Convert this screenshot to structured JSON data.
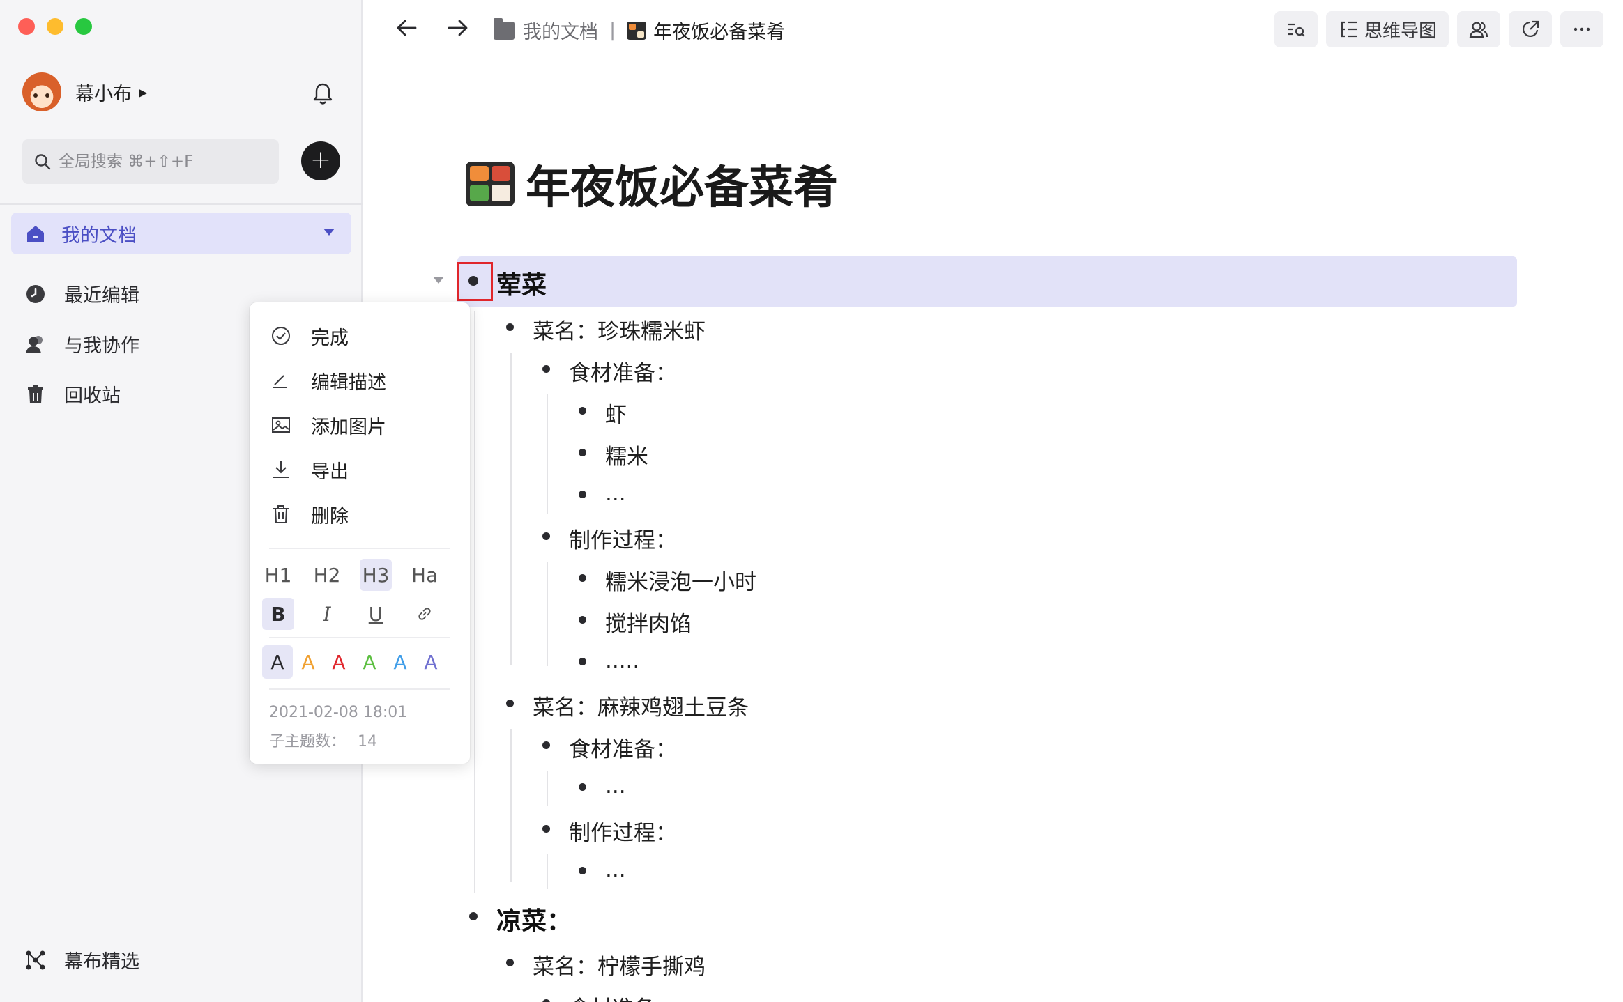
{
  "sidebar": {
    "user_name": "幕小布",
    "search_placeholder": "全局搜索 ⌘+⇧+F",
    "nav": {
      "my_docs": "我的文档",
      "recent": "最近编辑",
      "shared": "与我协作",
      "trash": "回收站"
    },
    "bottom": "幕布精选"
  },
  "topbar": {
    "folder": "我的文档",
    "separator": "|",
    "doc_name": "年夜饭必备菜肴",
    "mindmap_label": "思维导图"
  },
  "document": {
    "title": "年夜饭必备菜肴",
    "lines": [
      "荤菜",
      "菜名：珍珠糯米虾",
      "食材准备：",
      "虾",
      "糯米",
      "...",
      "制作过程：",
      "糯米浸泡一小时",
      "搅拌肉馅",
      ".....",
      "菜名：麻辣鸡翅土豆条",
      "食材准备：",
      "...",
      "制作过程：",
      "...",
      "凉菜：",
      "菜名：柠檬手撕鸡",
      "食材准备："
    ]
  },
  "context_menu": {
    "items": [
      "完成",
      "编辑描述",
      "添加图片",
      "导出",
      "删除"
    ],
    "headings": [
      "H1",
      "H2",
      "H3",
      "Ha"
    ],
    "active_heading": "H3",
    "style_labels": {
      "bold": "B",
      "italic": "I",
      "underline": "U"
    },
    "color_letter": "A",
    "colors": [
      "#2a2a2e",
      "#f0a030",
      "#e0262c",
      "#5cbf40",
      "#3f9de8",
      "#6f6fd0"
    ],
    "timestamp": "2021-02-08 18:01",
    "child_count_label": "子主题数：",
    "child_count": "14"
  },
  "colors": {
    "accent": "#4b4fc4",
    "selection": "#e2e2f8",
    "highlight_box": "#e0262c"
  }
}
